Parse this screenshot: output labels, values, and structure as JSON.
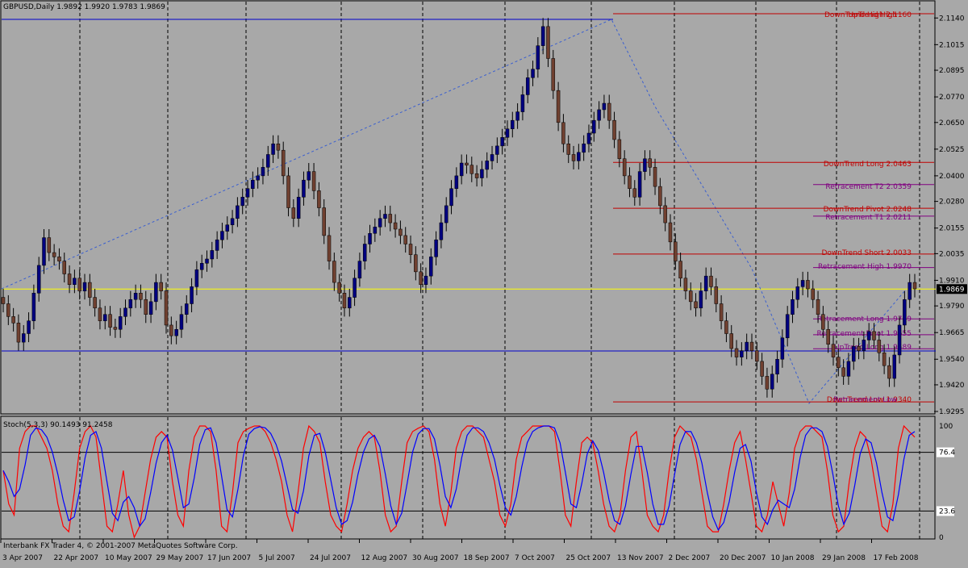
{
  "window": {
    "symbol_header": "GBPUSD,Daily  1.9892 1.9920 1.9783 1.9869",
    "current_price_label": "1.9869",
    "copyright": "Interbank FX Trader 4, © 2001-2007 MetaQuotes Software Corp."
  },
  "price_axis": {
    "ticks": [
      "2.1140",
      "2.1015",
      "2.0895",
      "2.0770",
      "2.0650",
      "2.0525",
      "2.0400",
      "2.0280",
      "2.0155",
      "2.0035",
      "1.9910",
      "1.9790",
      "1.9665",
      "1.9540",
      "1.9420",
      "1.9295"
    ]
  },
  "date_axis": {
    "labels": [
      "3 Apr 2007",
      "22 Apr 2007",
      "10 May 2007",
      "29 May 2007",
      "17 Jun 2007",
      "5 Jul 2007",
      "24 Jul 2007",
      "12 Aug 2007",
      "30 Aug 2007",
      "18 Sep 2007",
      "7 Oct 2007",
      "25 Oct 2007",
      "13 Nov 2007",
      "2 Dec 2007",
      "20 Dec 2007",
      "10 Jan 2008",
      "29 Jan 2008",
      "17 Feb 2008"
    ]
  },
  "levels": [
    {
      "label": "DownTrend High  2.1160",
      "color": "#c00000"
    },
    {
      "label": "UpTrend High",
      "color": "#c00000"
    },
    {
      "label": "DownTrend Long  2.0463",
      "color": "#c00000"
    },
    {
      "label": "Retracement   T2  2.0359",
      "color": "#800080"
    },
    {
      "label": "DownTrend Pivot  2.0248",
      "color": "#c00000"
    },
    {
      "label": "Retracement   T1  2.0211",
      "color": "#800080"
    },
    {
      "label": "DownTrend Short  2.0033",
      "color": "#c00000"
    },
    {
      "label": "Retracement High  1.9970",
      "color": "#800080"
    },
    {
      "label": "Retracement Long  1.9729",
      "color": "#800080"
    },
    {
      "label": "Retracement Pivot  1.9655",
      "color": "#800080"
    },
    {
      "label": "UpTrend Long  1.9589",
      "color": "#800080"
    },
    {
      "label": "DownTrend Low  1.9340",
      "color": "#c00000"
    },
    {
      "label": "Retracement Low",
      "color": "#800080"
    }
  ],
  "stochastic": {
    "header": "Stoch(5,3,3) 90.1493 91.2458",
    "ticks": [
      "100",
      "76.4",
      "23.6",
      "0"
    ],
    "main_color": "#ff0000",
    "signal_color": "#0000ff"
  },
  "chart_data": {
    "type": "candlestick",
    "symbol": "GBPUSD",
    "timeframe": "Daily",
    "last_bar": {
      "open": 1.9892,
      "high": 1.992,
      "low": 1.9783,
      "close": 1.9869
    },
    "ylim": [
      1.9295,
      2.116
    ],
    "key_levels": {
      "downtrend_high": 2.116,
      "downtrend_long": 2.0463,
      "retracement_t2": 2.0359,
      "downtrend_pivot": 2.0248,
      "retracement_t1": 2.0211,
      "downtrend_short": 2.0033,
      "retracement_high": 1.997,
      "retracement_long": 1.9729,
      "retracement_pivot": 1.9655,
      "uptrend_long": 1.9589,
      "downtrend_low": 1.934,
      "current": 1.9869
    },
    "closes": [
      1.98,
      1.974,
      1.971,
      1.962,
      1.966,
      1.972,
      1.985,
      1.998,
      2.011,
      2.004,
      2.002,
      2.0,
      1.994,
      1.989,
      1.992,
      1.986,
      1.99,
      1.983,
      1.978,
      1.972,
      1.975,
      1.969,
      1.968,
      1.974,
      1.978,
      1.982,
      1.985,
      1.982,
      1.975,
      1.981,
      1.99,
      1.986,
      1.97,
      1.965,
      1.968,
      1.975,
      1.98,
      1.988,
      1.996,
      1.999,
      2.001,
      2.005,
      2.01,
      2.014,
      2.017,
      2.02,
      2.026,
      2.03,
      2.034,
      2.038,
      2.04,
      2.044,
      2.05,
      2.055,
      2.052,
      2.04,
      2.025,
      2.02,
      2.03,
      2.038,
      2.042,
      2.033,
      2.025,
      2.012,
      2.0,
      1.99,
      1.985,
      1.978,
      1.983,
      1.992,
      2.0,
      2.008,
      2.013,
      2.016,
      2.02,
      2.022,
      2.018,
      2.015,
      2.012,
      2.008,
      2.003,
      1.995,
      1.989,
      1.993,
      2.002,
      2.01,
      2.018,
      2.026,
      2.034,
      2.04,
      2.046,
      2.045,
      2.041,
      2.039,
      2.043,
      2.047,
      2.05,
      2.054,
      2.058,
      2.062,
      2.066,
      2.07,
      2.078,
      2.086,
      2.09,
      2.101,
      2.11,
      2.095,
      2.08,
      2.065,
      2.055,
      2.05,
      2.047,
      2.051,
      2.055,
      2.06,
      2.066,
      2.071,
      2.074,
      2.066,
      2.057,
      2.048,
      2.04,
      2.034,
      2.03,
      2.042,
      2.048,
      2.044,
      2.035,
      2.026,
      2.018,
      2.009,
      2.0,
      1.992,
      1.986,
      1.981,
      1.978,
      1.986,
      1.993,
      1.988,
      1.98,
      1.972,
      1.966,
      1.959,
      1.955,
      1.958,
      1.962,
      1.958,
      1.953,
      1.946,
      1.94,
      1.947,
      1.954,
      1.964,
      1.975,
      1.982,
      1.988,
      1.991,
      1.987,
      1.982,
      1.975,
      1.968,
      1.961,
      1.955,
      1.95,
      1.946,
      1.953,
      1.96,
      1.958,
      1.963,
      1.967,
      1.963,
      1.957,
      1.951,
      1.945,
      1.956,
      1.97,
      1.982,
      1.99,
      1.987
    ],
    "stoch_main": [
      60,
      30,
      20,
      80,
      95,
      100,
      100,
      90,
      80,
      60,
      30,
      10,
      5,
      40,
      80,
      95,
      100,
      90,
      50,
      10,
      5,
      30,
      60,
      20,
      0,
      10,
      40,
      70,
      90,
      95,
      90,
      50,
      20,
      10,
      60,
      90,
      100,
      100,
      95,
      60,
      10,
      5,
      40,
      85,
      95,
      98,
      100,
      100,
      95,
      85,
      70,
      50,
      20,
      5,
      40,
      80,
      100,
      95,
      85,
      50,
      20,
      10,
      5,
      30,
      60,
      80,
      90,
      95,
      90,
      60,
      20,
      5,
      10,
      50,
      85,
      95,
      98,
      100,
      95,
      70,
      30,
      10,
      40,
      80,
      95,
      100,
      100,
      95,
      90,
      70,
      50,
      20,
      10,
      30,
      70,
      90,
      95,
      100,
      100,
      100,
      100,
      95,
      60,
      20,
      10,
      50,
      85,
      90,
      85,
      60,
      30,
      10,
      5,
      20,
      60,
      90,
      95,
      60,
      20,
      10,
      5,
      20,
      60,
      90,
      100,
      95,
      90,
      70,
      40,
      10,
      5,
      5,
      30,
      60,
      85,
      95,
      70,
      40,
      10,
      5,
      20,
      50,
      30,
      10,
      40,
      80,
      95,
      100,
      100,
      95,
      90,
      60,
      20,
      5,
      10,
      50,
      80,
      95,
      90,
      70,
      40,
      10,
      5,
      30,
      80,
      100,
      95,
      90
    ]
  }
}
